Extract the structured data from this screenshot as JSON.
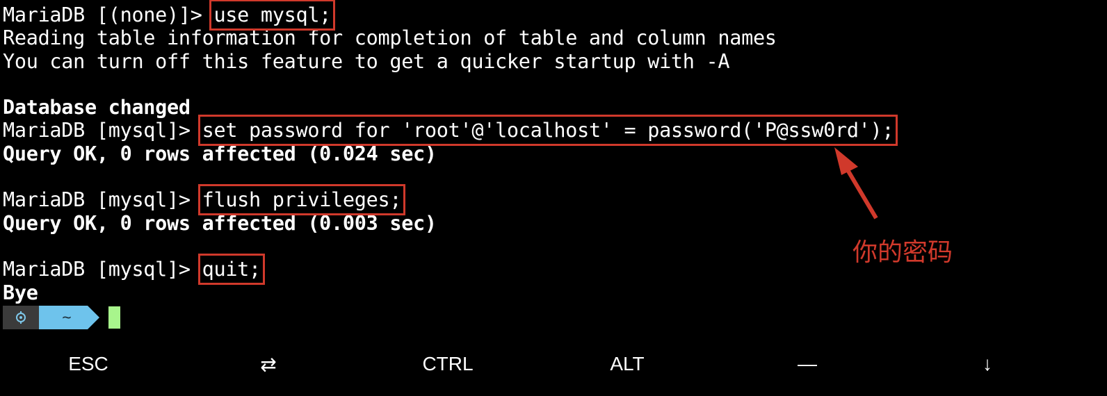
{
  "terminal": {
    "lines": [
      {
        "prompt": "MariaDB [(none)]> ",
        "command": "use mysql;"
      },
      {
        "text": "Reading table information for completion of table and column names"
      },
      {
        "text": "You can turn off this feature to get a quicker startup with -A"
      },
      {
        "text": ""
      },
      {
        "text": "Database changed"
      },
      {
        "prompt": "MariaDB [mysql]> ",
        "command": "set password for 'root'@'localhost' = password('P@ssw0rd');"
      },
      {
        "text": "Query OK, 0 rows affected (0.024 sec)"
      },
      {
        "text": ""
      },
      {
        "prompt": "MariaDB [mysql]> ",
        "command": "flush privileges;"
      },
      {
        "text": "Query OK, 0 rows affected (0.003 sec)"
      },
      {
        "text": ""
      },
      {
        "prompt": "MariaDB [mysql]> ",
        "command": "quit;"
      },
      {
        "text": "Bye"
      }
    ],
    "shell_prompt": {
      "icon": "gear-icon",
      "dir": "~"
    }
  },
  "annotation": {
    "label": "你的密码",
    "color": "#d0392b"
  },
  "extra_keys": {
    "esc": "ESC",
    "tab_icon": "⇄",
    "ctrl": "CTRL",
    "alt": "ALT",
    "dash": "—",
    "down": "↓"
  },
  "colors": {
    "background": "#000000",
    "text": "#ffffff",
    "highlight_box": "#d0392b",
    "cursor": "#a8f58c",
    "prompt_dir_bg": "#6ec3ec"
  }
}
